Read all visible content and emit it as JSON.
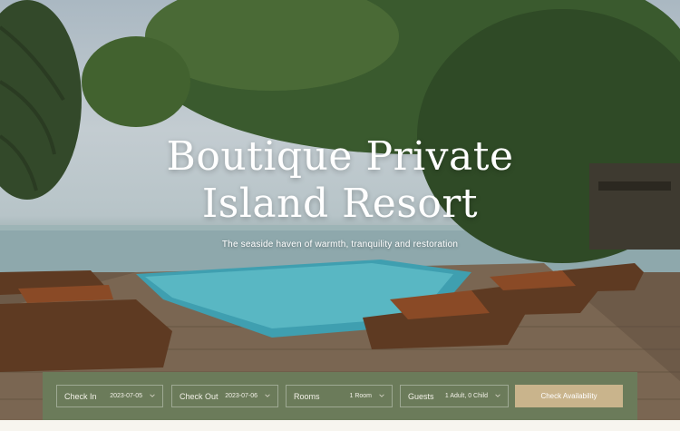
{
  "hero": {
    "title_line1": "Boutique Private",
    "title_line2": "Island Resort",
    "subtitle": "The seaside haven of warmth, tranquility and restoration"
  },
  "booking": {
    "check_in": {
      "label": "Check In",
      "value": "2023-07-05"
    },
    "check_out": {
      "label": "Check Out",
      "value": "2023-07-06"
    },
    "rooms": {
      "label": "Rooms",
      "value": "1 Room"
    },
    "guests": {
      "label": "Guests",
      "value": "1 Adult, 0 Child"
    },
    "submit_label": "Check Availability"
  },
  "colors": {
    "booking_bar": "#6b7b5a",
    "button": "#c9b48c",
    "page_background": "#f7f5ef"
  },
  "icons": {
    "dropdown": "chevron-down-icon"
  }
}
